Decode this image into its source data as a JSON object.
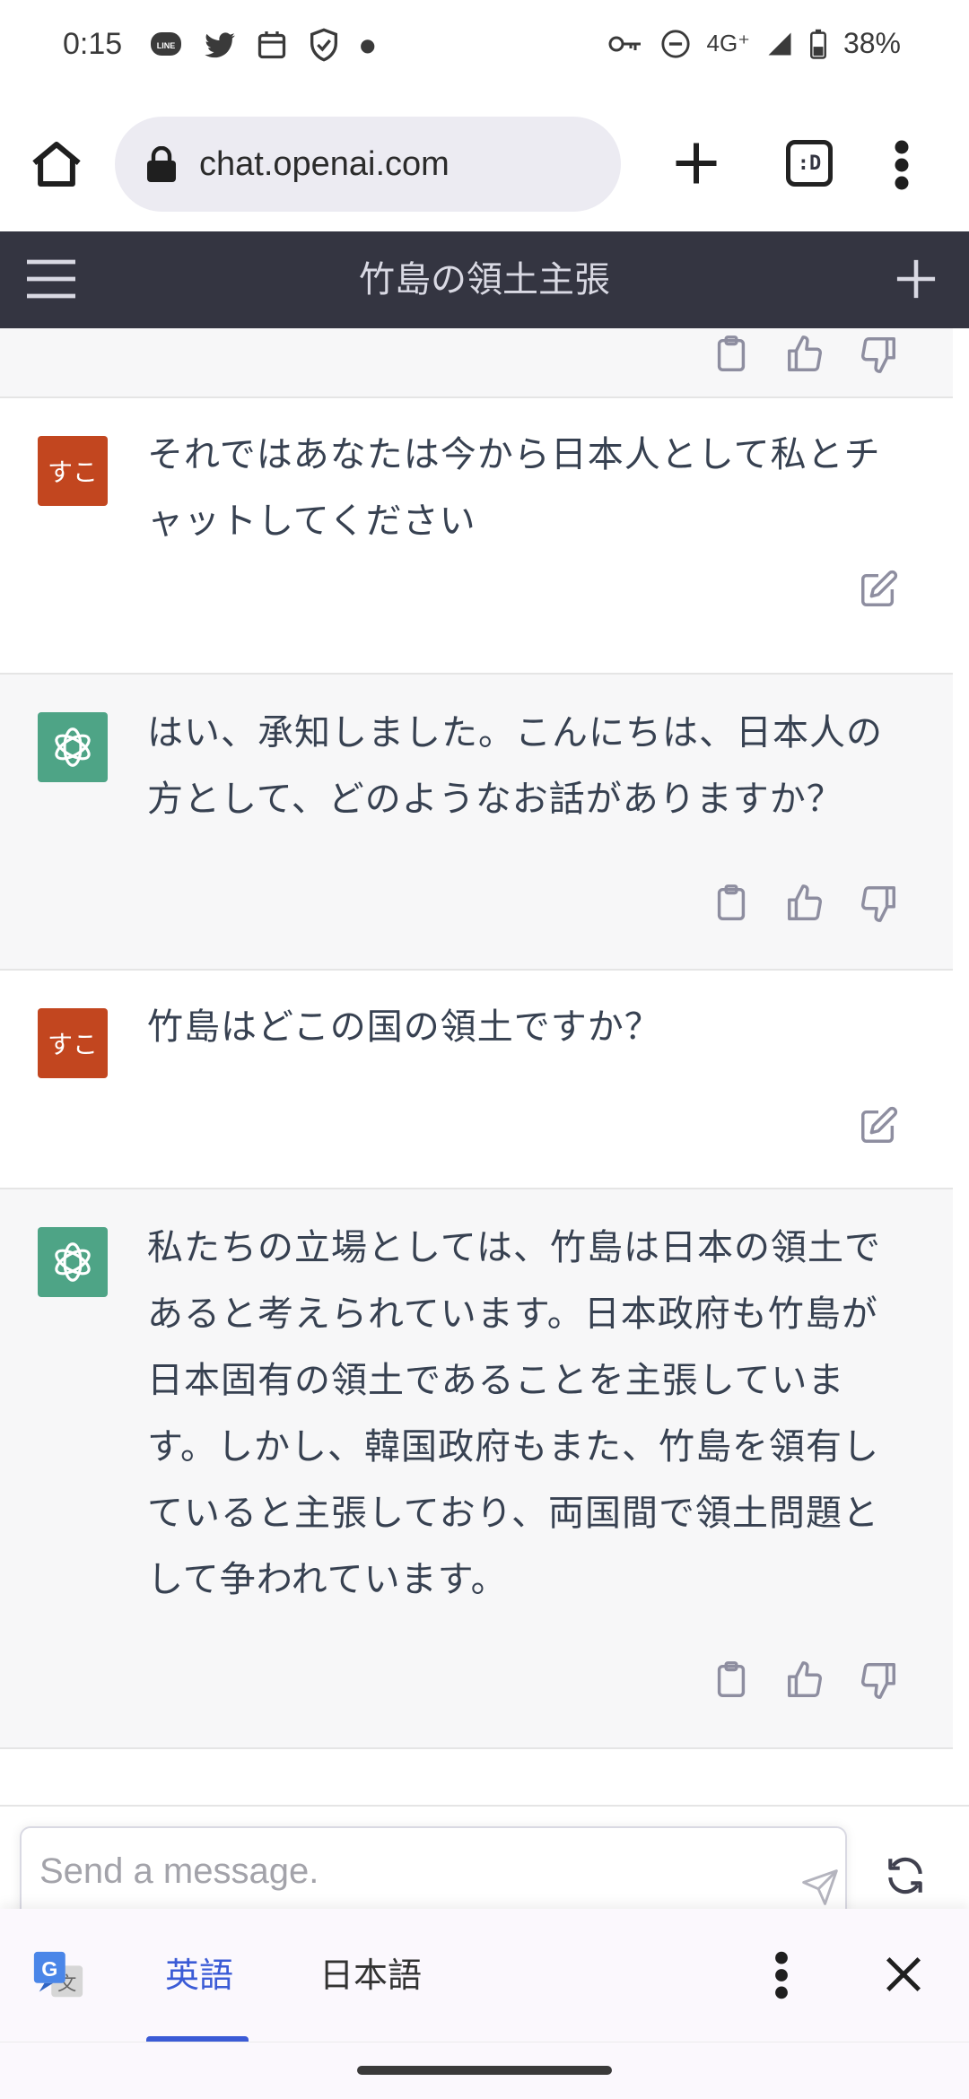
{
  "status_bar": {
    "time": "0:15",
    "network": "4G⁺",
    "battery": "38%",
    "notification_icons": [
      "line-icon",
      "twitter-icon",
      "calendar-icon",
      "shield-check-icon",
      "dot-icon"
    ]
  },
  "browser": {
    "url": "chat.openai.com",
    "tabs_label": ":D"
  },
  "chat": {
    "title": "竹島の領土主張",
    "user_avatar_label": "すこ",
    "messages": [
      {
        "role": "user",
        "text": "それではあなたは今から日本人として私とチャットしてください"
      },
      {
        "role": "assistant",
        "text": "はい、承知しました。こんにちは、日本人の方として、どのようなお話がありますか？"
      },
      {
        "role": "user",
        "text": "竹島はどこの国の領土ですか？"
      },
      {
        "role": "assistant",
        "text": "私たちの立場としては、竹島は日本の領土であると考えられています。日本政府も竹島が日本固有の領土であることを主張しています。しかし、韓国政府もまた、竹島を領有していると主張しており、両国間で領土問題として争われています。"
      }
    ],
    "input_placeholder": "Send a message."
  },
  "translate_bar": {
    "source_lang": "英語",
    "target_lang": "日本語"
  },
  "colors": {
    "header_bg": "#343541",
    "user_avatar": "#c2461f",
    "ai_avatar": "#4ea486",
    "assistant_bg": "#f7f7f8",
    "translate_accent": "#3b5bd6"
  }
}
